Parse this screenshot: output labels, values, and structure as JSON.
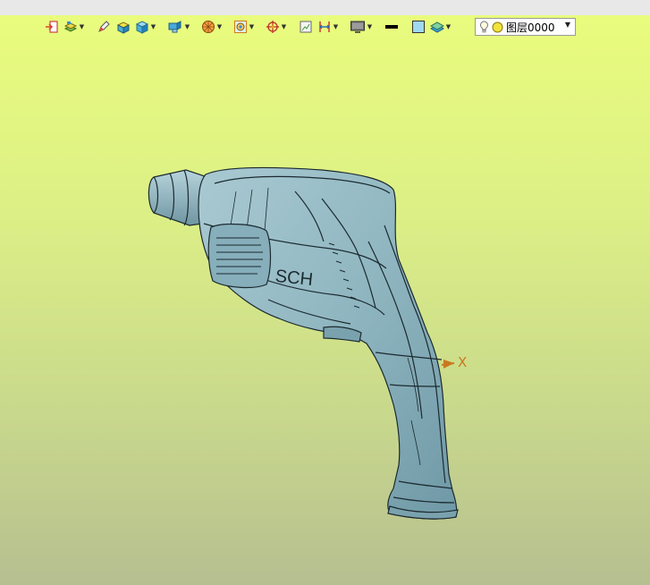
{
  "toolbar": {
    "tools": [
      {
        "icon": "import-icon",
        "dropdown": false
      },
      {
        "icon": "layers-stack-icon",
        "dropdown": true
      },
      {
        "icon": "pen-sketch-icon",
        "dropdown": false
      },
      {
        "icon": "shaded-box-icon",
        "dropdown": false
      },
      {
        "icon": "solid-cube-icon",
        "dropdown": true
      },
      {
        "icon": "view-orientation-icon",
        "dropdown": true
      },
      {
        "icon": "render-sphere-icon",
        "dropdown": true
      },
      {
        "icon": "display-mode-icon",
        "dropdown": true
      },
      {
        "icon": "origin-target-icon",
        "dropdown": true
      },
      {
        "icon": "frame-view-icon",
        "dropdown": false
      },
      {
        "icon": "dimension-icon",
        "dropdown": true
      },
      {
        "icon": "monitor-icon",
        "dropdown": true
      },
      {
        "icon": "line-color-icon",
        "dropdown": false
      },
      {
        "icon": "fill-color-icon",
        "dropdown": false
      },
      {
        "icon": "layer-manager-icon",
        "dropdown": true
      }
    ]
  },
  "layer": {
    "name": "图层0000",
    "bulb_icon": "lightbulb-icon",
    "state_icon": "visible-dot-icon"
  },
  "model": {
    "axis_label": "X",
    "brand_text": "SCH",
    "colors": {
      "body": "#8fb6c0",
      "edges": "#1c2a30",
      "axis": "#c9781e",
      "background_top": "#e9fc7d",
      "background_bottom": "#b6bf90"
    }
  }
}
